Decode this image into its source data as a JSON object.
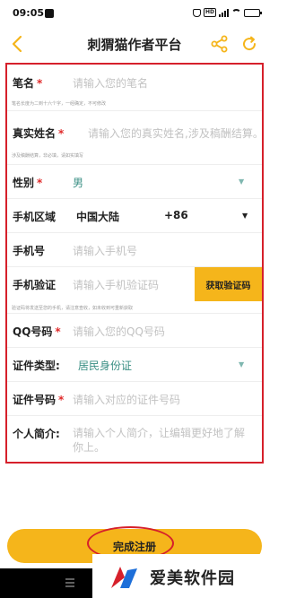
{
  "status_bar": {
    "time": "09:05",
    "network_badge": "HD",
    "battery_level": 0.85
  },
  "header": {
    "title": "刺猬猫作者平台",
    "back_icon": "chevron-left-icon",
    "share_icon": "share-icon",
    "refresh_icon": "refresh-icon",
    "accent_color": "#f5b51b"
  },
  "form": {
    "highlight_color": "#d6202b",
    "pen_name": {
      "label": "笔名",
      "required": "*",
      "placeholder": "请输入您的笔名",
      "hint": "笔名长度为二到十六个字，一经确定，不可修改"
    },
    "real_name": {
      "label": "真实姓名",
      "required": "*",
      "placeholder": "请输入您的真实姓名,涉及稿酬结算。",
      "hint": "涉及稿酬结算，非必填，请如实填写"
    },
    "gender": {
      "label": "性别",
      "required": "*",
      "value": "男"
    },
    "phone_region": {
      "label": "手机区域",
      "region": "中国大陆",
      "code": "+86"
    },
    "phone": {
      "label": "手机号",
      "placeholder": "请输入手机号"
    },
    "verify": {
      "label": "手机验证",
      "placeholder": "请输入手机验证码",
      "button": "获取验证码",
      "hint": "验证码将发送至您的手机，请注意查收，如未收到可重新获取"
    },
    "qq": {
      "label": "QQ号码",
      "required": "*",
      "placeholder": "请输入您的QQ号码"
    },
    "id_type": {
      "label": "证件类型:",
      "value": "居民身份证"
    },
    "id_number": {
      "label": "证件号码",
      "required": "*",
      "placeholder": "请输入对应的证件号码"
    },
    "intro": {
      "label": "个人简介:",
      "placeholder": "请输入个人简介，让编辑更好地了解你上。"
    }
  },
  "submit": {
    "label": "完成注册"
  },
  "watermark": {
    "text": "爱美软件园"
  }
}
